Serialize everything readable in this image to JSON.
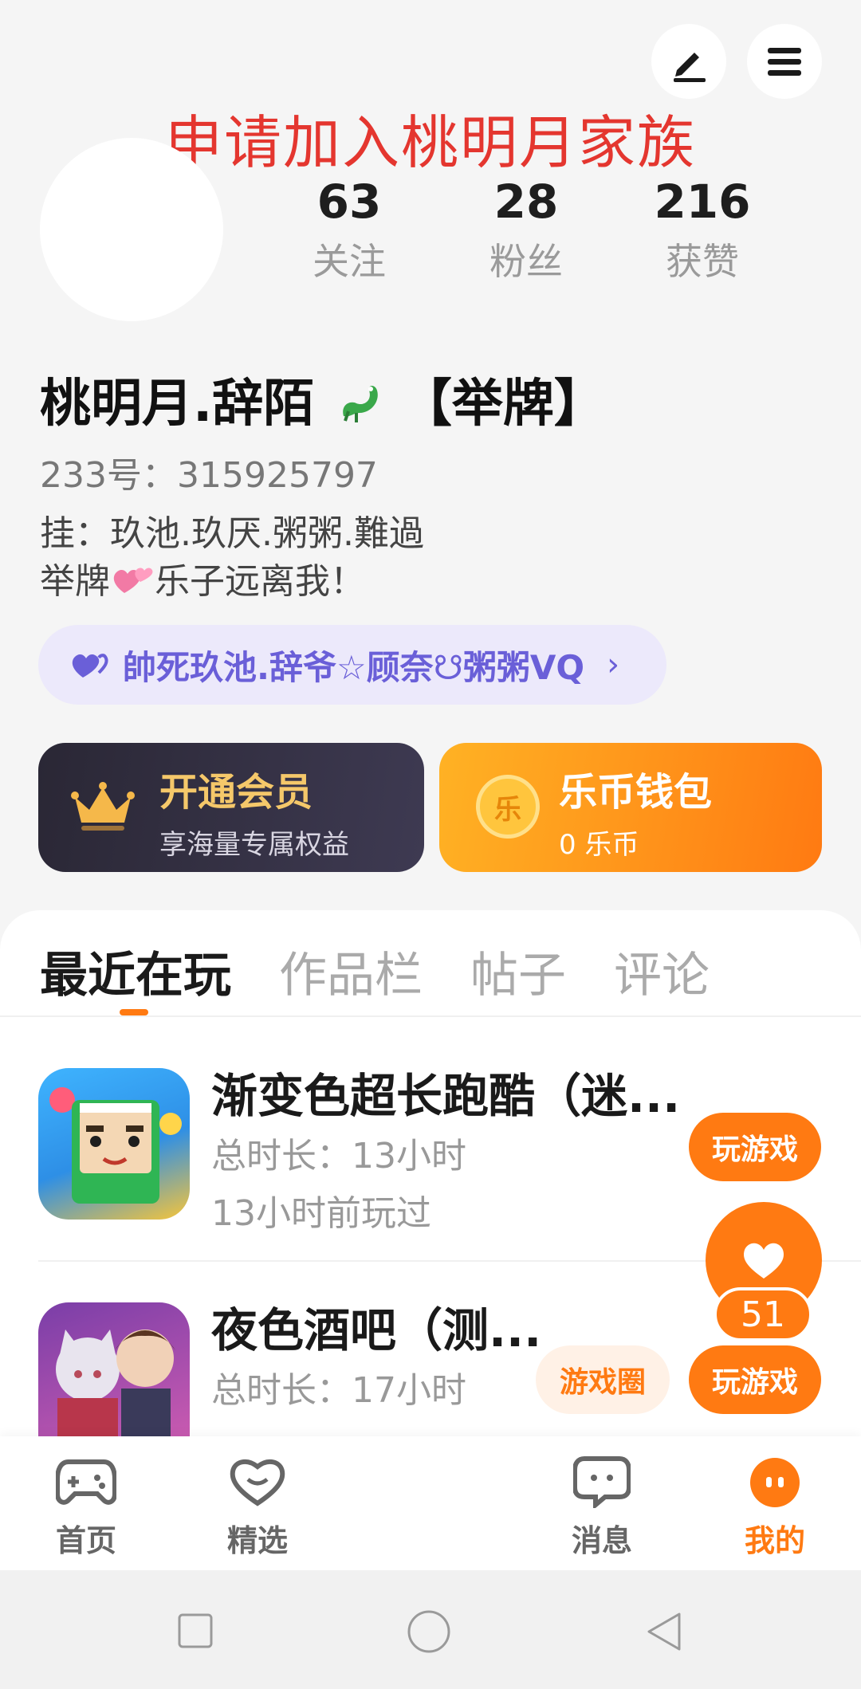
{
  "header": {
    "banner": "申请加入桃明月家族",
    "edit_icon": "pencil-icon",
    "menu_icon": "hamburger-icon"
  },
  "profile": {
    "stats": [
      {
        "value": "63",
        "label": "关注"
      },
      {
        "value": "28",
        "label": "粉丝"
      },
      {
        "value": "216",
        "label": "获赞"
      }
    ],
    "name": "桃明月.辞陌",
    "name_suffix": "【举牌】",
    "id_line": "233号：315925797",
    "bio_line1": "挂：玖池.玖厌.粥粥.難過",
    "bio_line2_a": "举牌",
    "bio_line2_b": "乐子远离我！",
    "family_link": "帥死玖池.辞爷☆顾奈☋粥粥VQ"
  },
  "cards": {
    "vip_title": "开通会员",
    "vip_sub": "享海量专属权益",
    "wallet_title": "乐币钱包",
    "wallet_sub": "0 乐币",
    "coin_glyph": "乐"
  },
  "tabs": [
    "最近在玩",
    "作品栏",
    "帖子",
    "评论"
  ],
  "games": [
    {
      "title": "渐变色超长跑酷（迷...",
      "duration": "总时长：13小时",
      "last_played": "13小时前玩过",
      "play_label": "玩游戏"
    },
    {
      "title": "夜色酒吧（测...",
      "duration": "总时长：17小时",
      "circle_label": "游戏圈",
      "play_label": "玩游戏"
    }
  ],
  "floating_like": {
    "count": "51"
  },
  "bottom_nav": [
    {
      "label": "首页",
      "icon": "gamepad-icon"
    },
    {
      "label": "精选",
      "icon": "heart-chat-icon"
    },
    {
      "label": "消息",
      "icon": "message-icon"
    },
    {
      "label": "我的",
      "icon": "me-icon"
    }
  ],
  "colors": {
    "accent": "#ff7a12",
    "banner": "#e4362f",
    "family": "#6a5fd8",
    "vip_gold": "#f5c86a"
  }
}
